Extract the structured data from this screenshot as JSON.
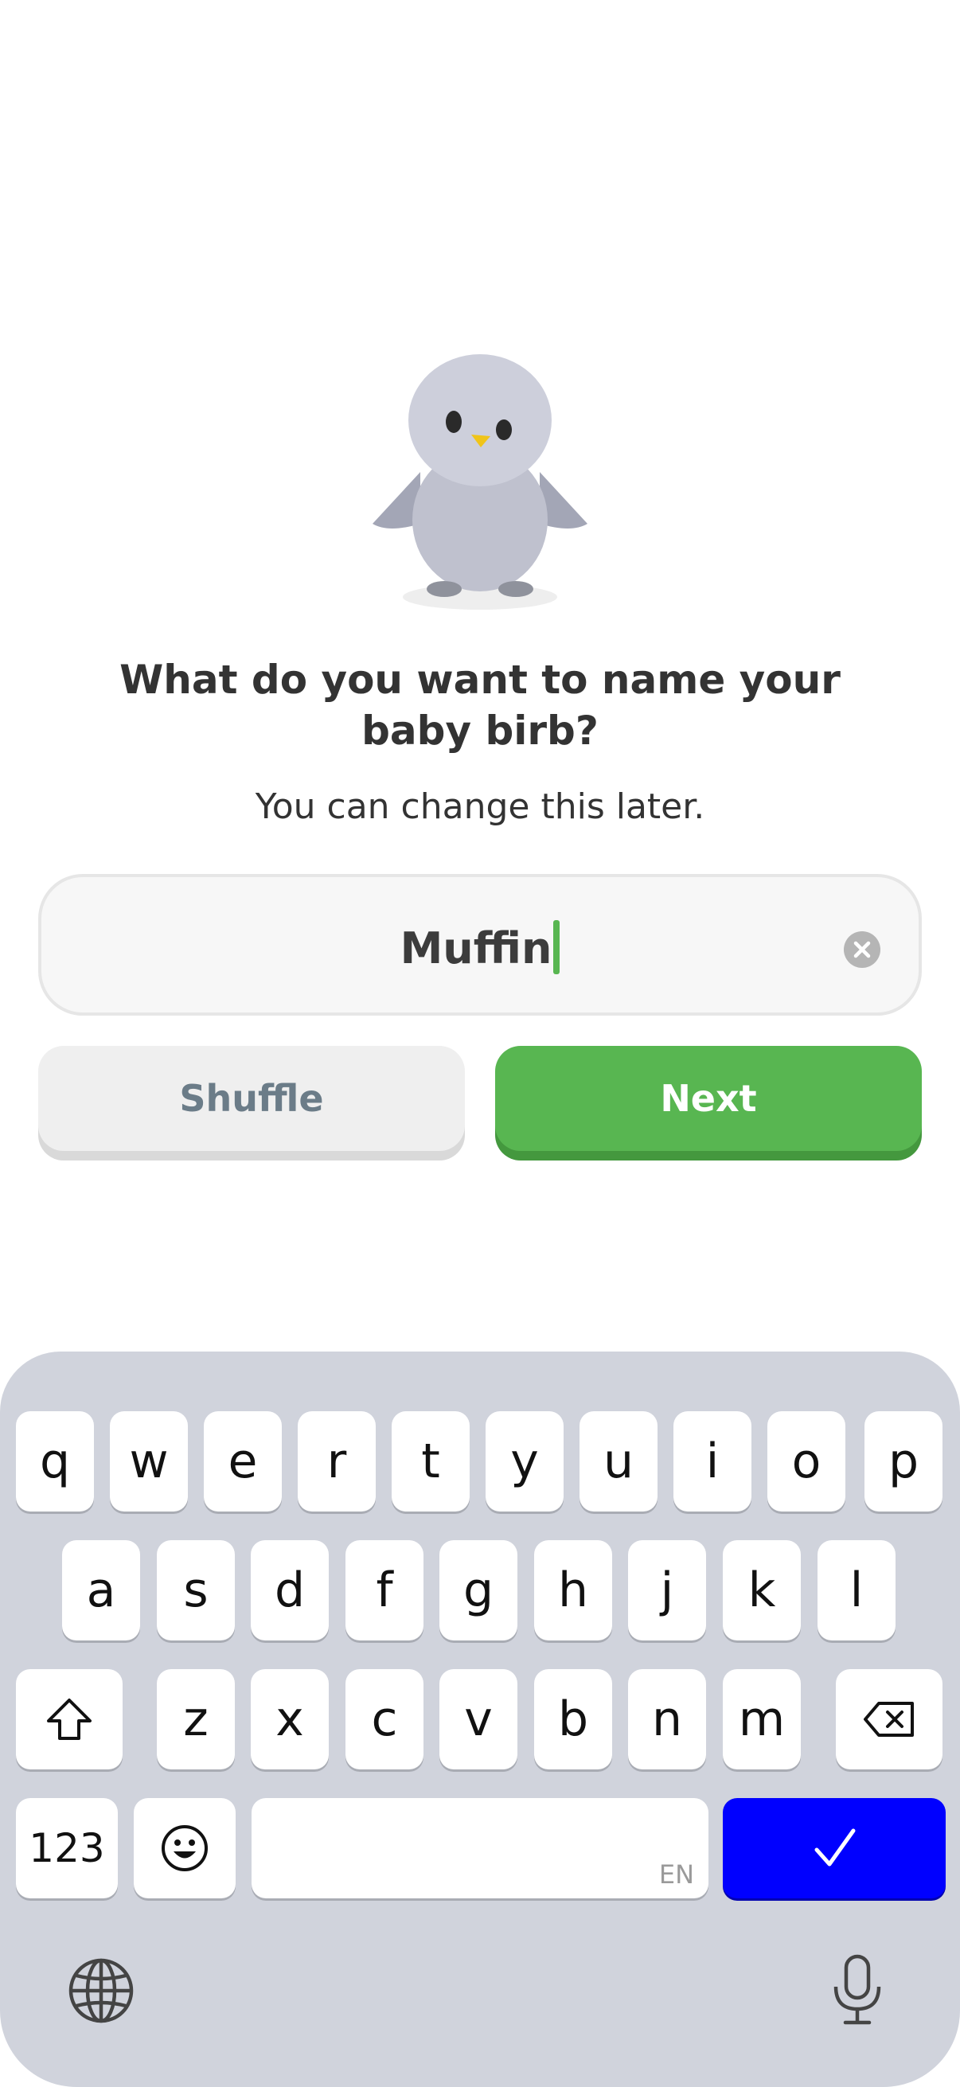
{
  "prompt": {
    "question": "What do you want to name your baby birb?",
    "subtitle": "You can change this later."
  },
  "name_field": {
    "value": "Muffin"
  },
  "buttons": {
    "shuffle": "Shuffle",
    "next": "Next"
  },
  "colors": {
    "accent_green": "#58b651",
    "keyboard_done": "#0000ff",
    "keyboard_bg": "#d0d3dc"
  },
  "keyboard": {
    "row1": [
      "q",
      "w",
      "e",
      "r",
      "t",
      "y",
      "u",
      "i",
      "o",
      "p"
    ],
    "row2": [
      "a",
      "s",
      "d",
      "f",
      "g",
      "h",
      "j",
      "k",
      "l"
    ],
    "row3": [
      "z",
      "x",
      "c",
      "v",
      "b",
      "n",
      "m"
    ],
    "numbers_label": "123",
    "space_lang": "EN",
    "icons": {
      "shift": "shift-icon",
      "backspace": "backspace-icon",
      "emoji": "emoji-icon",
      "done": "checkmark-icon",
      "globe": "globe-icon",
      "mic": "microphone-icon"
    }
  }
}
